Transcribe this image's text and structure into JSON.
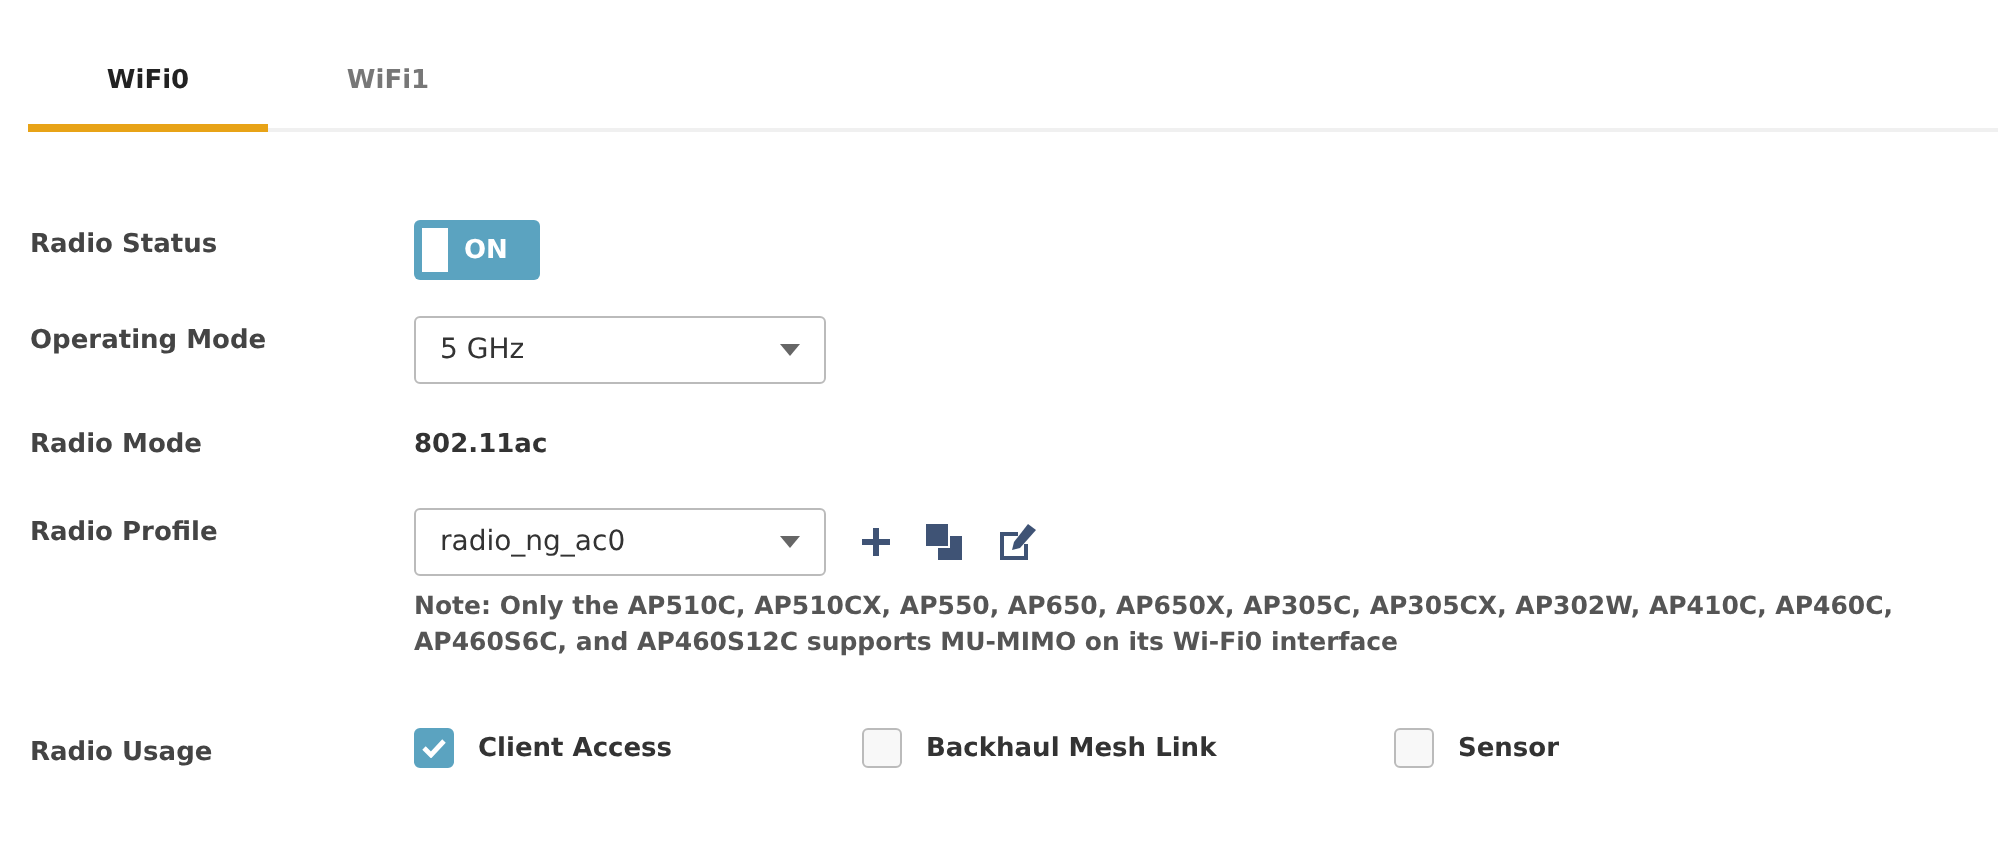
{
  "tabs": [
    {
      "label": "WiFi0",
      "selected": true
    },
    {
      "label": "WiFi1",
      "selected": false
    }
  ],
  "radio_status": {
    "label": "Radio Status",
    "toggle_text": "ON",
    "on": true
  },
  "operating_mode": {
    "label": "Operating Mode",
    "value": "5 GHz"
  },
  "radio_mode": {
    "label": "Radio Mode",
    "value": "802.11ac"
  },
  "radio_profile": {
    "label": "Radio Profile",
    "value": "radio_ng_ac0",
    "note": "Note: Only the AP510C, AP510CX, AP550, AP650, AP650X, AP305C, AP305CX, AP302W, AP410C, AP460C, AP460S6C, and AP460S12C supports MU-MIMO on its Wi-Fi0 interface"
  },
  "radio_usage": {
    "label": "Radio Usage",
    "options": [
      {
        "label": "Client Access",
        "checked": true
      },
      {
        "label": "Backhaul Mesh Link",
        "checked": false
      },
      {
        "label": "Sensor",
        "checked": false
      }
    ]
  }
}
